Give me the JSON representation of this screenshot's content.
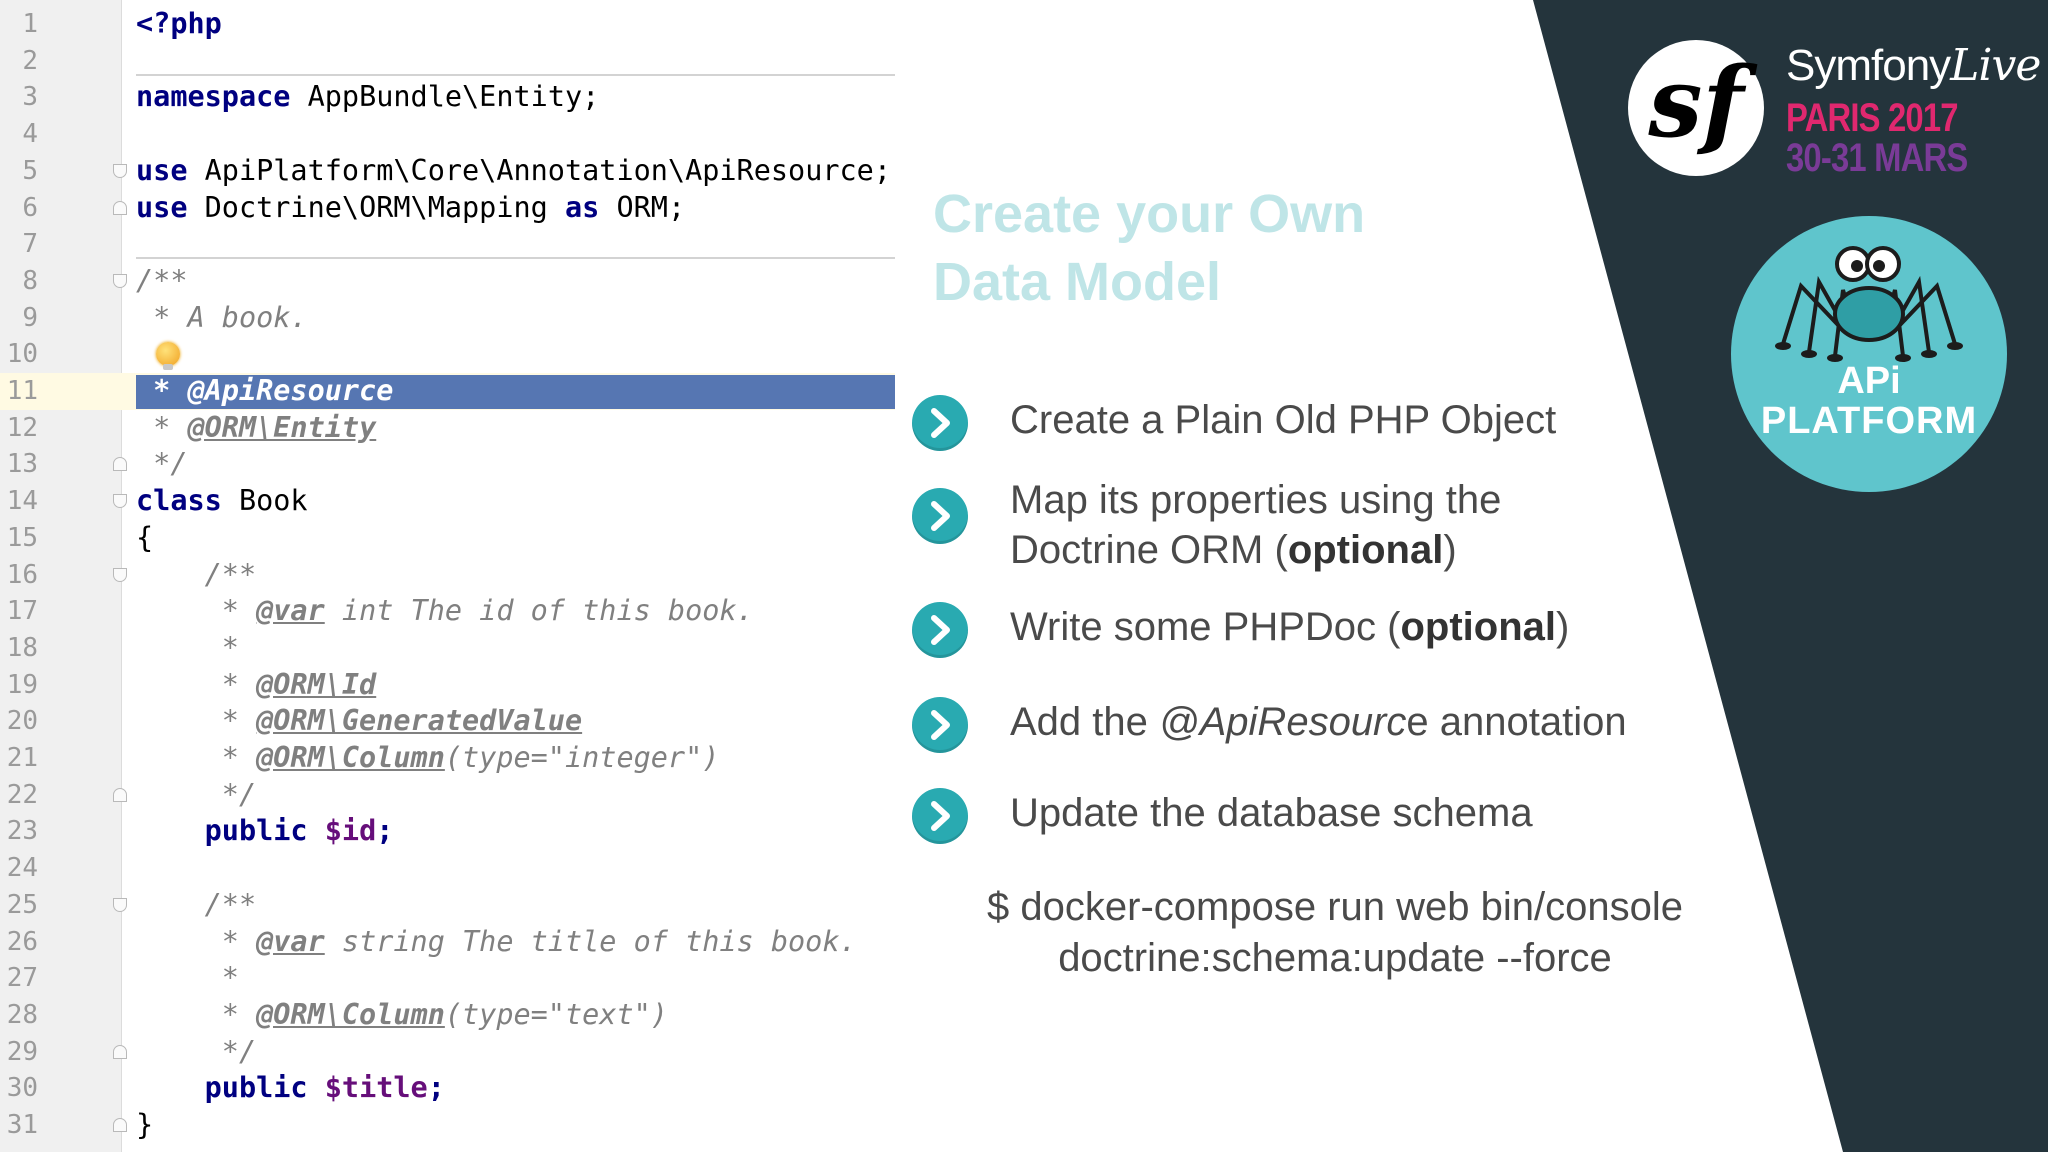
{
  "editor": {
    "lines": [
      {
        "n": "1",
        "code": [
          {
            "t": "<?php",
            "c": "kw"
          }
        ]
      },
      {
        "n": "2",
        "code": []
      },
      {
        "n": "3",
        "code": [
          {
            "t": "namespace",
            "c": "kw"
          },
          {
            "t": " AppBundle\\Entity;",
            "c": ""
          }
        ]
      },
      {
        "n": "4",
        "code": []
      },
      {
        "n": "5",
        "code": [
          {
            "t": "use",
            "c": "kw"
          },
          {
            "t": " ApiPlatform\\Core\\Annotation\\ApiResource;",
            "c": ""
          }
        ],
        "fold": "open"
      },
      {
        "n": "6",
        "code": [
          {
            "t": "use",
            "c": "kw"
          },
          {
            "t": " Doctrine\\ORM\\Mapping ",
            "c": ""
          },
          {
            "t": "as",
            "c": "kw"
          },
          {
            "t": " ORM;",
            "c": ""
          }
        ],
        "fold": "close"
      },
      {
        "n": "7",
        "code": []
      },
      {
        "n": "8",
        "code": [
          {
            "t": "/**",
            "c": "cm"
          }
        ],
        "fold": "open"
      },
      {
        "n": "9",
        "code": [
          {
            "t": " * A book.",
            "c": "cm"
          }
        ]
      },
      {
        "n": "10",
        "code": [],
        "bulb": true
      },
      {
        "n": "11",
        "code": [],
        "highlight": " * @ApiResource"
      },
      {
        "n": "12",
        "code": [
          {
            "t": " * ",
            "c": "cm"
          },
          {
            "t": "@ORM\\Entity",
            "c": "tag"
          }
        ]
      },
      {
        "n": "13",
        "code": [
          {
            "t": " */",
            "c": "cm"
          }
        ],
        "fold": "close"
      },
      {
        "n": "14",
        "code": [
          {
            "t": "class",
            "c": "kw"
          },
          {
            "t": " Book",
            "c": ""
          }
        ],
        "fold": "open"
      },
      {
        "n": "15",
        "code": [
          {
            "t": "{",
            "c": ""
          }
        ]
      },
      {
        "n": "16",
        "code": [
          {
            "t": "    /**",
            "c": "cm"
          }
        ],
        "fold": "open"
      },
      {
        "n": "17",
        "code": [
          {
            "t": "     * ",
            "c": "cm"
          },
          {
            "t": "@var",
            "c": "tag"
          },
          {
            "t": " int The id of this book.",
            "c": "cm"
          }
        ]
      },
      {
        "n": "18",
        "code": [
          {
            "t": "     *",
            "c": "cm"
          }
        ]
      },
      {
        "n": "19",
        "code": [
          {
            "t": "     * ",
            "c": "cm"
          },
          {
            "t": "@ORM\\Id",
            "c": "tag"
          }
        ]
      },
      {
        "n": "20",
        "code": [
          {
            "t": "     * ",
            "c": "cm"
          },
          {
            "t": "@ORM\\GeneratedValue",
            "c": "tag"
          }
        ]
      },
      {
        "n": "21",
        "code": [
          {
            "t": "     * ",
            "c": "cm"
          },
          {
            "t": "@ORM\\Column",
            "c": "tag"
          },
          {
            "t": "(type=\"integer\")",
            "c": "str"
          }
        ]
      },
      {
        "n": "22",
        "code": [
          {
            "t": "     */",
            "c": "cm"
          }
        ],
        "fold": "close"
      },
      {
        "n": "23",
        "code": [
          {
            "t": "    public ",
            "c": "kw"
          },
          {
            "t": "$id",
            "c": "var"
          },
          {
            "t": ";",
            "c": "kw"
          }
        ]
      },
      {
        "n": "24",
        "code": []
      },
      {
        "n": "25",
        "code": [
          {
            "t": "    /**",
            "c": "cm"
          }
        ],
        "fold": "open"
      },
      {
        "n": "26",
        "code": [
          {
            "t": "     * ",
            "c": "cm"
          },
          {
            "t": "@var",
            "c": "tag"
          },
          {
            "t": " string The title of this book.",
            "c": "cm"
          }
        ]
      },
      {
        "n": "27",
        "code": [
          {
            "t": "     *",
            "c": "cm"
          }
        ]
      },
      {
        "n": "28",
        "code": [
          {
            "t": "     * ",
            "c": "cm"
          },
          {
            "t": "@ORM\\Column",
            "c": "tag"
          },
          {
            "t": "(type=\"text\")",
            "c": "str"
          }
        ]
      },
      {
        "n": "29",
        "code": [
          {
            "t": "     */",
            "c": "cm"
          }
        ],
        "fold": "close"
      },
      {
        "n": "30",
        "code": [
          {
            "t": "    public ",
            "c": "kw"
          },
          {
            "t": "$title",
            "c": "var"
          },
          {
            "t": ";",
            "c": "kw"
          }
        ]
      },
      {
        "n": "31",
        "code": [
          {
            "t": "}",
            "c": ""
          }
        ],
        "fold": "close"
      }
    ]
  },
  "slide": {
    "title_line1": "Create your Own",
    "title_line2": "Data Model",
    "bullets": [
      {
        "parts": [
          {
            "t": "Create a Plain Old PHP Object",
            "s": ""
          }
        ]
      },
      {
        "parts": [
          {
            "t": "Map its properties using the",
            "s": ""
          },
          {
            "t": "\n",
            "s": "br"
          },
          {
            "t": "Doctrine ORM (",
            "s": ""
          },
          {
            "t": "optional",
            "s": "b"
          },
          {
            "t": ")",
            "s": ""
          }
        ]
      },
      {
        "parts": [
          {
            "t": "Write some PHPDoc (",
            "s": ""
          },
          {
            "t": "optional",
            "s": "b"
          },
          {
            "t": ")",
            "s": ""
          }
        ]
      },
      {
        "parts": [
          {
            "t": "Add the ",
            "s": ""
          },
          {
            "t": "@ApiResourc",
            "s": "i"
          },
          {
            "t": "e annotation",
            "s": ""
          }
        ]
      },
      {
        "parts": [
          {
            "t": "Update the database schema",
            "s": ""
          }
        ]
      }
    ],
    "command_line1": "$ docker-compose run web bin/console",
    "command_line2": "doctrine:schema:update --force",
    "accent_color": "#29aab1",
    "title_color": "#bfe5e7"
  },
  "brand": {
    "sf_glyph": "sf",
    "event_name_a": "Symfony",
    "event_name_b": "Live",
    "event_city": "PARIS 2017",
    "event_date": "30-31 MARS",
    "api_line1": "APi",
    "api_line2": "PLATFORM",
    "panel_color": "#24343c",
    "api_color": "#5fc5cc"
  }
}
